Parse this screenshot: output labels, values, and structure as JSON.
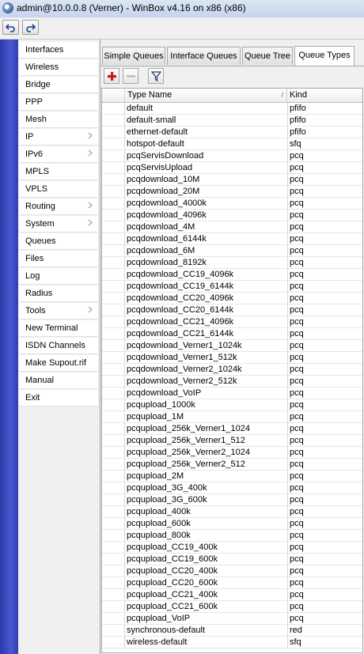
{
  "window": {
    "title": "admin@10.0.0.8 (Verner) - WinBox v4.16 on x86 (x86)"
  },
  "toolbar": {
    "undo_icon": "undo-icon",
    "redo_icon": "redo-icon"
  },
  "sidebar": {
    "items": [
      {
        "label": "Interfaces",
        "arrow": false
      },
      {
        "label": "Wireless",
        "arrow": false
      },
      {
        "label": "Bridge",
        "arrow": false
      },
      {
        "label": "PPP",
        "arrow": false
      },
      {
        "label": "Mesh",
        "arrow": false
      },
      {
        "label": "IP",
        "arrow": true
      },
      {
        "label": "IPv6",
        "arrow": true
      },
      {
        "label": "MPLS",
        "arrow": false
      },
      {
        "label": "VPLS",
        "arrow": false
      },
      {
        "label": "Routing",
        "arrow": true
      },
      {
        "label": "System",
        "arrow": true
      },
      {
        "label": "Queues",
        "arrow": false
      },
      {
        "label": "Files",
        "arrow": false
      },
      {
        "label": "Log",
        "arrow": false
      },
      {
        "label": "Radius",
        "arrow": false
      },
      {
        "label": "Tools",
        "arrow": true
      },
      {
        "label": "New Terminal",
        "arrow": false
      },
      {
        "label": "ISDN Channels",
        "arrow": false
      },
      {
        "label": "Make Supout.rif",
        "arrow": false
      },
      {
        "label": "Manual",
        "arrow": false
      },
      {
        "label": "Exit",
        "arrow": false
      }
    ]
  },
  "tabs": [
    {
      "label": "Simple Queues",
      "active": false
    },
    {
      "label": "Interface Queues",
      "active": false
    },
    {
      "label": "Queue Tree",
      "active": false
    },
    {
      "label": "Queue Types",
      "active": true
    }
  ],
  "actions": {
    "add_icon": "plus-icon",
    "remove_icon": "minus-icon",
    "filter_icon": "filter-icon"
  },
  "table": {
    "columns": [
      "Type Name",
      "Kind"
    ],
    "rows": [
      [
        "default",
        "pfifo"
      ],
      [
        "default-small",
        "pfifo"
      ],
      [
        "ethernet-default",
        "pfifo"
      ],
      [
        "hotspot-default",
        "sfq"
      ],
      [
        "pcqServisDownload",
        "pcq"
      ],
      [
        "pcqServisUpload",
        "pcq"
      ],
      [
        "pcqdownload_10M",
        "pcq"
      ],
      [
        "pcqdownload_20M",
        "pcq"
      ],
      [
        "pcqdownload_4000k",
        "pcq"
      ],
      [
        "pcqdownload_4096k",
        "pcq"
      ],
      [
        "pcqdownload_4M",
        "pcq"
      ],
      [
        "pcqdownload_6144k",
        "pcq"
      ],
      [
        "pcqdownload_6M",
        "pcq"
      ],
      [
        "pcqdownload_8192k",
        "pcq"
      ],
      [
        "pcqdownload_CC19_4096k",
        "pcq"
      ],
      [
        "pcqdownload_CC19_6144k",
        "pcq"
      ],
      [
        "pcqdownload_CC20_4096k",
        "pcq"
      ],
      [
        "pcqdownload_CC20_6144k",
        "pcq"
      ],
      [
        "pcqdownload_CC21_4096k",
        "pcq"
      ],
      [
        "pcqdownload_CC21_6144k",
        "pcq"
      ],
      [
        "pcqdownload_Verner1_1024k",
        "pcq"
      ],
      [
        "pcqdownload_Verner1_512k",
        "pcq"
      ],
      [
        "pcqdownload_Verner2_1024k",
        "pcq"
      ],
      [
        "pcqdownload_Verner2_512k",
        "pcq"
      ],
      [
        "pcqdownload_VoIP",
        "pcq"
      ],
      [
        "pcqupload_1000k",
        "pcq"
      ],
      [
        "pcqupload_1M",
        "pcq"
      ],
      [
        "pcqupload_256k_Verner1_1024",
        "pcq"
      ],
      [
        "pcqupload_256k_Verner1_512",
        "pcq"
      ],
      [
        "pcqupload_256k_Verner2_1024",
        "pcq"
      ],
      [
        "pcqupload_256k_Verner2_512",
        "pcq"
      ],
      [
        "pcqupload_2M",
        "pcq"
      ],
      [
        "pcqupload_3G_400k",
        "pcq"
      ],
      [
        "pcqupload_3G_600k",
        "pcq"
      ],
      [
        "pcqupload_400k",
        "pcq"
      ],
      [
        "pcqupload_600k",
        "pcq"
      ],
      [
        "pcqupload_800k",
        "pcq"
      ],
      [
        "pcqupload_CC19_400k",
        "pcq"
      ],
      [
        "pcqupload_CC19_600k",
        "pcq"
      ],
      [
        "pcqupload_CC20_400k",
        "pcq"
      ],
      [
        "pcqupload_CC20_600k",
        "pcq"
      ],
      [
        "pcqupload_CC21_400k",
        "pcq"
      ],
      [
        "pcqupload_CC21_600k",
        "pcq"
      ],
      [
        "pcqupload_VoIP",
        "pcq"
      ],
      [
        "synchronous-default",
        "red"
      ],
      [
        "wireless-default",
        "sfq"
      ]
    ]
  }
}
